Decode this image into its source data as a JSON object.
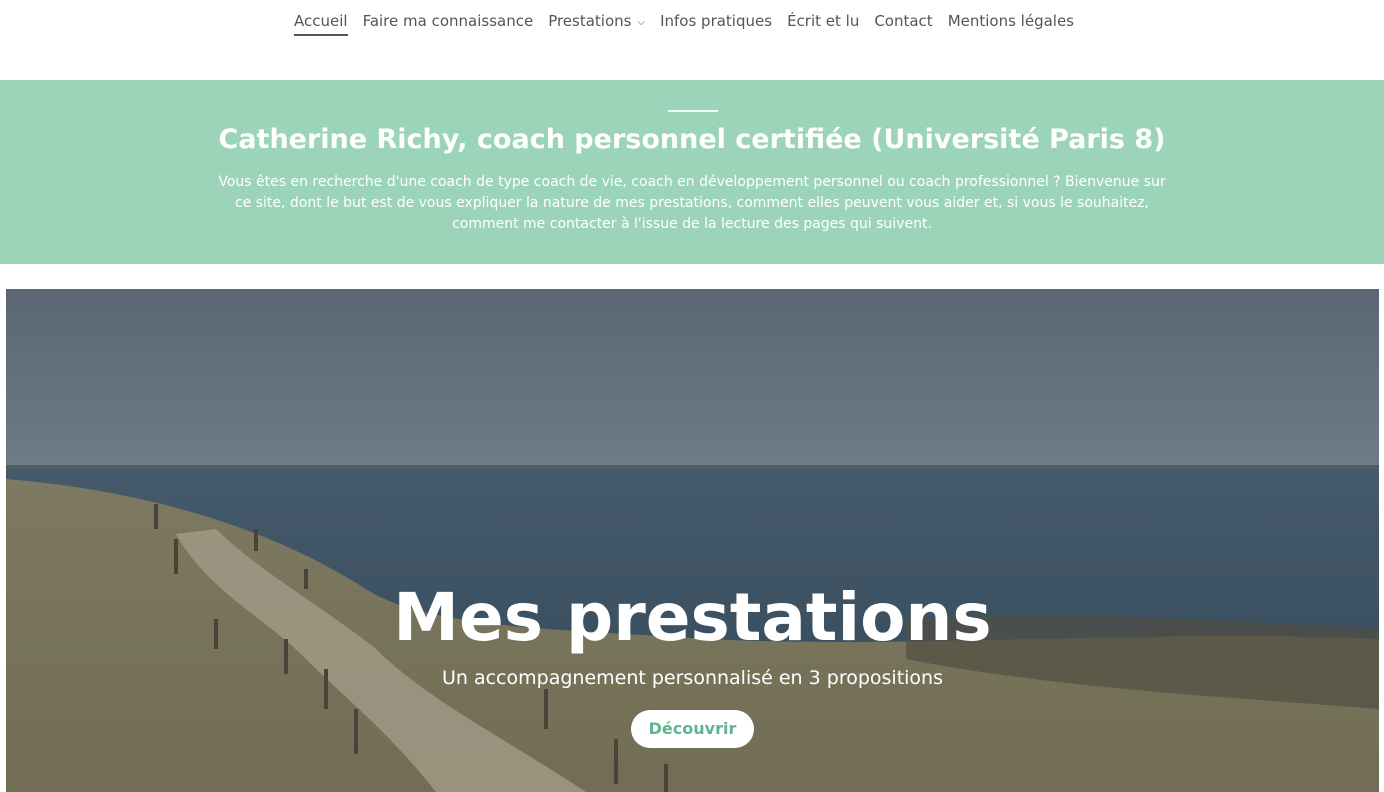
{
  "nav": {
    "items": [
      {
        "label": "Accueil",
        "active": true
      },
      {
        "label": "Faire ma connaissance"
      },
      {
        "label": "Prestations",
        "has_dropdown": true,
        "icon": "chevron-down-icon"
      },
      {
        "label": "Infos pratiques"
      },
      {
        "label": "Écrit et lu"
      },
      {
        "label": "Contact"
      },
      {
        "label": "Mentions légales"
      }
    ]
  },
  "intro": {
    "title": "Catherine Richy, coach personnel certifiée (Université Paris 8)",
    "text": "Vous êtes en recherche d'une coach de type coach de vie, coach en développement personnel ou coach professionnel ? Bienvenue sur ce site, dont le but est de vous expliquer la nature de mes prestations, comment elles peuvent vous aider et, si vous le souhaitez, comment me contacter à l'issue de la lecture des pages qui suivent."
  },
  "hero": {
    "title": "Mes prestations",
    "subtitle": "Un accompagnement personnalisé en 3 propositions",
    "button_label": "Découvrir"
  },
  "colors": {
    "accent": "#9cd4b9",
    "button_text": "#5fb48f",
    "nav_text": "#555555"
  }
}
